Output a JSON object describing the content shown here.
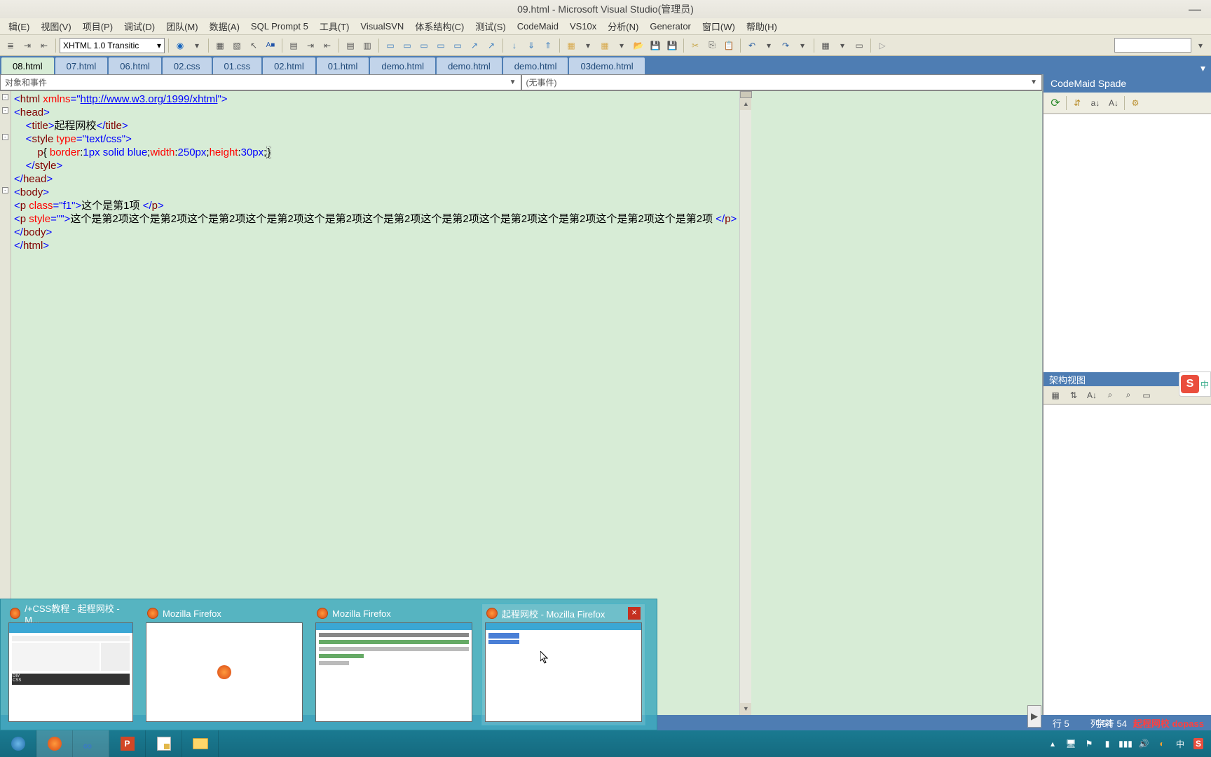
{
  "window": {
    "title": "09.html - Microsoft Visual Studio(管理员)"
  },
  "menus": [
    "辑(E)",
    "视图(V)",
    "项目(P)",
    "调试(D)",
    "团队(M)",
    "数据(A)",
    "SQL Prompt 5",
    "工具(T)",
    "VisualSVN",
    "体系结构(C)",
    "测试(S)",
    "CodeMaid",
    "VS10x",
    "分析(N)",
    "Generator",
    "窗口(W)",
    "帮助(H)"
  ],
  "toolbar": {
    "doctype": "XHTML 1.0 Transitic"
  },
  "tabs": [
    "08.html",
    "07.html",
    "06.html",
    "02.css",
    "01.css",
    "02.html",
    "01.html",
    "demo.html",
    "demo.html",
    "demo.html",
    "03demo.html"
  ],
  "activeTab": 0,
  "objectBar": {
    "left": "对象和事件",
    "right": "(无事件)"
  },
  "code": {
    "l1_attr": "xmlns",
    "l1_url": "http://www.w3.org/1999/xhtml",
    "l3_title": "起程网校",
    "l4_attr": "type",
    "l4_val": "text/css",
    "l5_css": "p{ border:1px solid blue;width:250px;height:30px;}",
    "l9_attr": "class",
    "l9_val": "f1",
    "l9_text": "这个是第1项 ",
    "l10_attr": "style",
    "l10_val": "",
    "l10_text": "这个是第2项这个是第2项这个是第2项这个是第2项这个是第2项这个是第2项这个是第2项这个是第2项这个是第2项这个是第2项这个是第2项 "
  },
  "rightPanel": {
    "title": "CodeMaid Spade",
    "title2": "架构视图"
  },
  "status": {
    "line_label": "行",
    "line": "5",
    "col_label": "列",
    "col": "54",
    "char_label": "字符",
    "char": "54",
    "red": "起程网校 dopass"
  },
  "previews": [
    {
      "title": "/+CSS教程 - 起程网校 - M..."
    },
    {
      "title": "Mozilla Firefox"
    },
    {
      "title": "Mozilla Firefox"
    },
    {
      "title": "起程网校 - Mozilla Firefox",
      "active": true
    }
  ],
  "sogou": {
    "letter": "S",
    "cn": "中"
  }
}
